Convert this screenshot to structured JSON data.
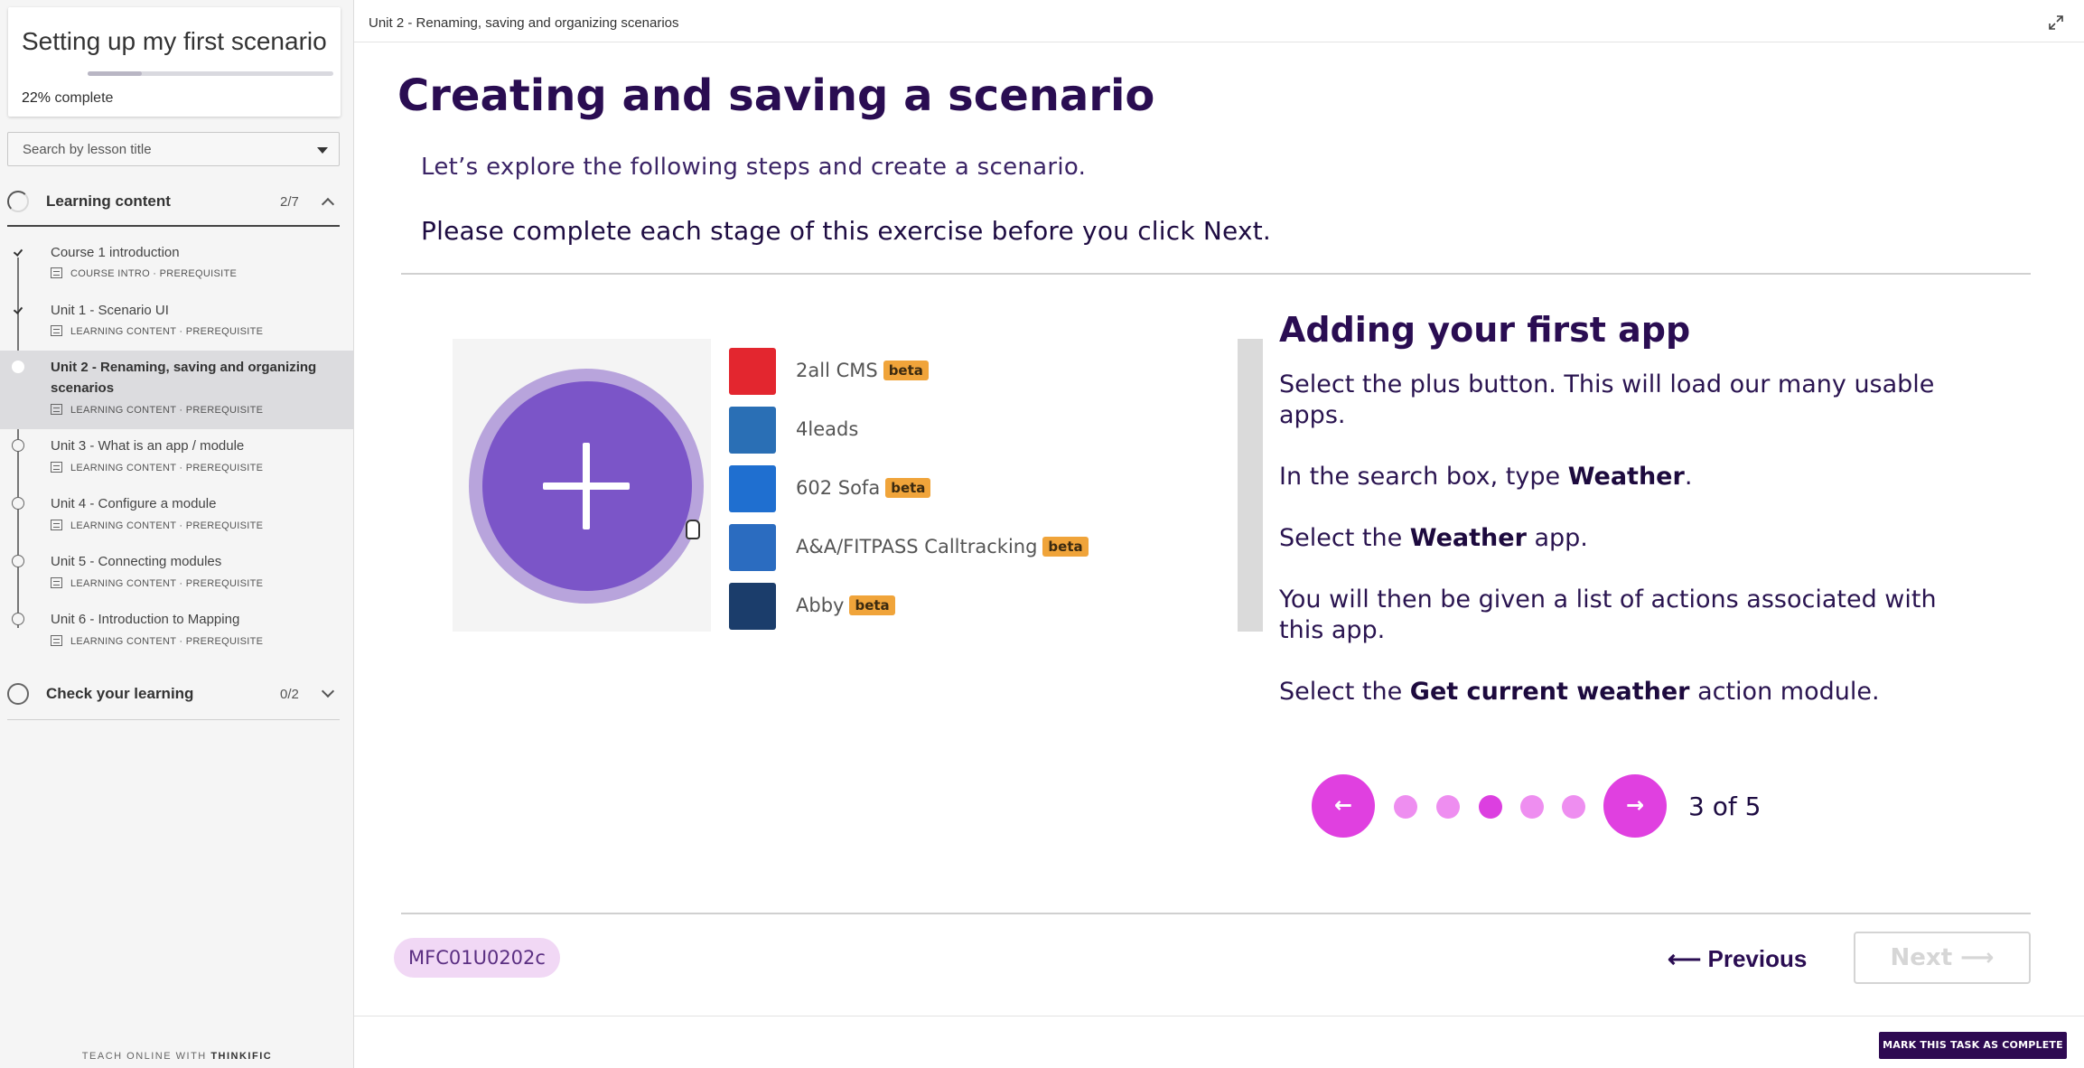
{
  "sidebar": {
    "course_title": "Setting up my first scenario",
    "progress_percent": 22,
    "progress_value": "22%",
    "progress_label": "complete",
    "search_placeholder": "Search by lesson title",
    "chapters": [
      {
        "title": "Learning content",
        "count": "2/7",
        "expanded": true,
        "lessons": [
          {
            "title": "Course 1 introduction",
            "meta": "COURSE INTRO · PREREQUISITE",
            "status": "complete"
          },
          {
            "title": "Unit 1 - Scenario UI",
            "meta": "LEARNING CONTENT · PREREQUISITE",
            "status": "complete"
          },
          {
            "title": "Unit 2 - Renaming, saving and organizing scenarios",
            "meta": "LEARNING CONTENT · PREREQUISITE",
            "status": "current"
          },
          {
            "title": "Unit 3 - What is an app / module",
            "meta": "LEARNING CONTENT · PREREQUISITE",
            "status": "incomplete"
          },
          {
            "title": "Unit 4 - Configure a module",
            "meta": "LEARNING CONTENT · PREREQUISITE",
            "status": "incomplete"
          },
          {
            "title": "Unit 5 - Connecting modules",
            "meta": "LEARNING CONTENT · PREREQUISITE",
            "status": "incomplete"
          },
          {
            "title": "Unit 6 - Introduction to Mapping",
            "meta": "LEARNING CONTENT · PREREQUISITE",
            "status": "incomplete"
          }
        ]
      },
      {
        "title": "Check your learning",
        "count": "0/2",
        "expanded": false
      }
    ],
    "footer_prefix": "TEACH ONLINE WITH",
    "footer_brand": "THINKIFIC"
  },
  "topbar": {
    "breadcrumb": "Unit 2 - Renaming, saving and organizing scenarios",
    "expand_icon": "expand-icon"
  },
  "main": {
    "title": "Creating and saving a scenario",
    "intro": "Let’s explore the following steps and create a scenario.",
    "warning": "Please complete each stage of this exercise before you click Next.",
    "screenshot_apps": [
      {
        "name": "2all CMS",
        "beta": "beta",
        "color": "#e3262f"
      },
      {
        "name": "4leads",
        "beta": "",
        "color": "#2a6fb5"
      },
      {
        "name": "602 Sofa",
        "beta": "beta",
        "color": "#1f6fd0"
      },
      {
        "name": "A&A/FITPASS Calltracking",
        "beta": "beta",
        "color": "#2b6cc0"
      },
      {
        "name": "Abby",
        "beta": "beta",
        "color": "#1b3d6b"
      }
    ],
    "steps_title": "Adding your first app",
    "steps": [
      {
        "pre": "Select the plus button. This will load our many usable apps.",
        "bold": "",
        "post": ""
      },
      {
        "pre": "In the search box, type ",
        "bold": "Weather",
        "post": "."
      },
      {
        "pre": "Select the ",
        "bold": "Weather",
        "post": " app."
      },
      {
        "pre": "You will then be given a list of actions associated with this app.",
        "bold": "",
        "post": ""
      },
      {
        "pre": "Select the ",
        "bold": "Get current weather",
        "post": " action module."
      }
    ],
    "carousel": {
      "current": 3,
      "total": 5,
      "counter_text": "3 of 5",
      "prev_icon": "arrow-left-icon",
      "next_icon": "arrow-right-icon"
    },
    "code": "MFC01U0202c",
    "previous_label": "Previous",
    "next_label": "Next",
    "mark_complete_label": "MARK THIS TASK AS COMPLETE"
  },
  "colors": {
    "accent": "#e040e0",
    "brand": "#2e0a52",
    "title": "#2a0d52"
  }
}
